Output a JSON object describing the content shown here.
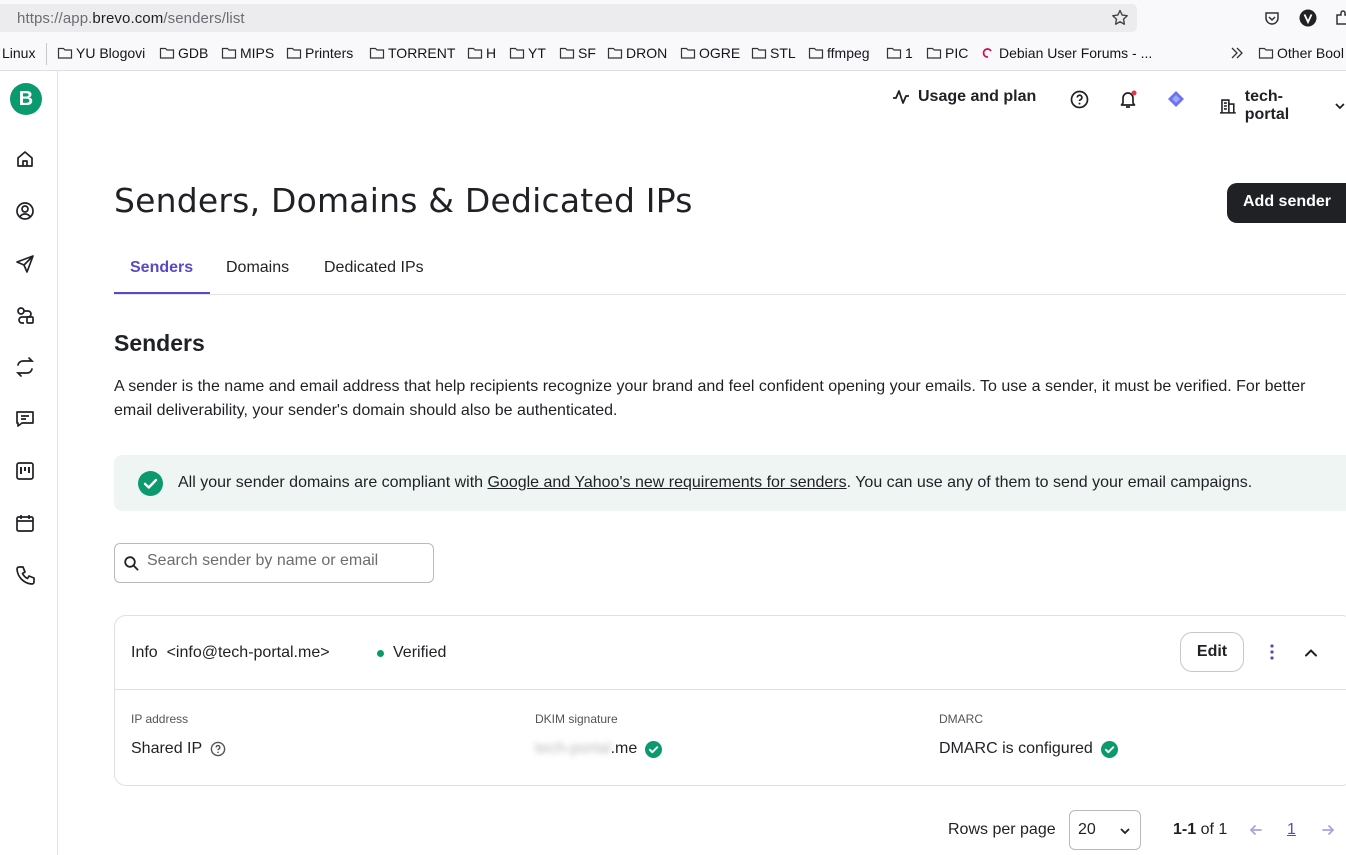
{
  "browser": {
    "url_prefix": "https://app.",
    "url_domain": "brevo.com",
    "url_path": "/senders/list",
    "bookmarks": [
      "Linux",
      "YU Blogovi",
      "GDB",
      "MIPS",
      "Printers",
      "TORRENT",
      "H",
      "YT",
      "SF",
      "DRON",
      "OGRE",
      "STL",
      "ffmpeg",
      "1",
      "PIC",
      "Debian User Forums - ...",
      "Other Bool"
    ]
  },
  "app": {
    "logo_letter": "B",
    "nav_icons": [
      "home-icon",
      "contacts-icon",
      "campaigns-icon",
      "automations-icon",
      "transactional-icon",
      "conversations-icon",
      "sales-icon",
      "meetings-icon",
      "phone-icon"
    ],
    "topbar": {
      "usage_label": "Usage and plan",
      "account_label": "tech-portal"
    },
    "accent_color": "#5a48c5",
    "brand_color": "#0b996e"
  },
  "page": {
    "title": "Senders, Domains & Dedicated IPs",
    "add_button": "Add sender",
    "tabs": [
      {
        "label": "Senders",
        "active": true
      },
      {
        "label": "Domains",
        "active": false
      },
      {
        "label": "Dedicated IPs",
        "active": false
      }
    ],
    "section_title": "Senders",
    "description": "A sender is the name and email address that help recipients recognize your brand and feel confident opening your emails. To use a sender, it must be verified. For better email deliverability, your sender's domain should also be authenticated.",
    "banner": {
      "pre": "All your sender domains are compliant with ",
      "link": "Google and Yahoo's new requirements for senders",
      "post": ". You can use any of them to send your email campaigns."
    },
    "search_placeholder": "Search sender by name or email"
  },
  "sender": {
    "name": "Info  <info@tech-portal.me>",
    "status": "Verified",
    "edit_label": "Edit",
    "ip_label": "IP address",
    "ip_value": "Shared IP",
    "dkim_label": "DKIM signature",
    "dkim_blurred": "tech-portal",
    "dkim_suffix": ".me",
    "dmarc_label": "DMARC",
    "dmarc_value": "DMARC is configured"
  },
  "pagination": {
    "rows_label": "Rows per page",
    "rows_value": "20",
    "range": "1-1",
    "of_text": "of 1",
    "current_page": "1"
  }
}
